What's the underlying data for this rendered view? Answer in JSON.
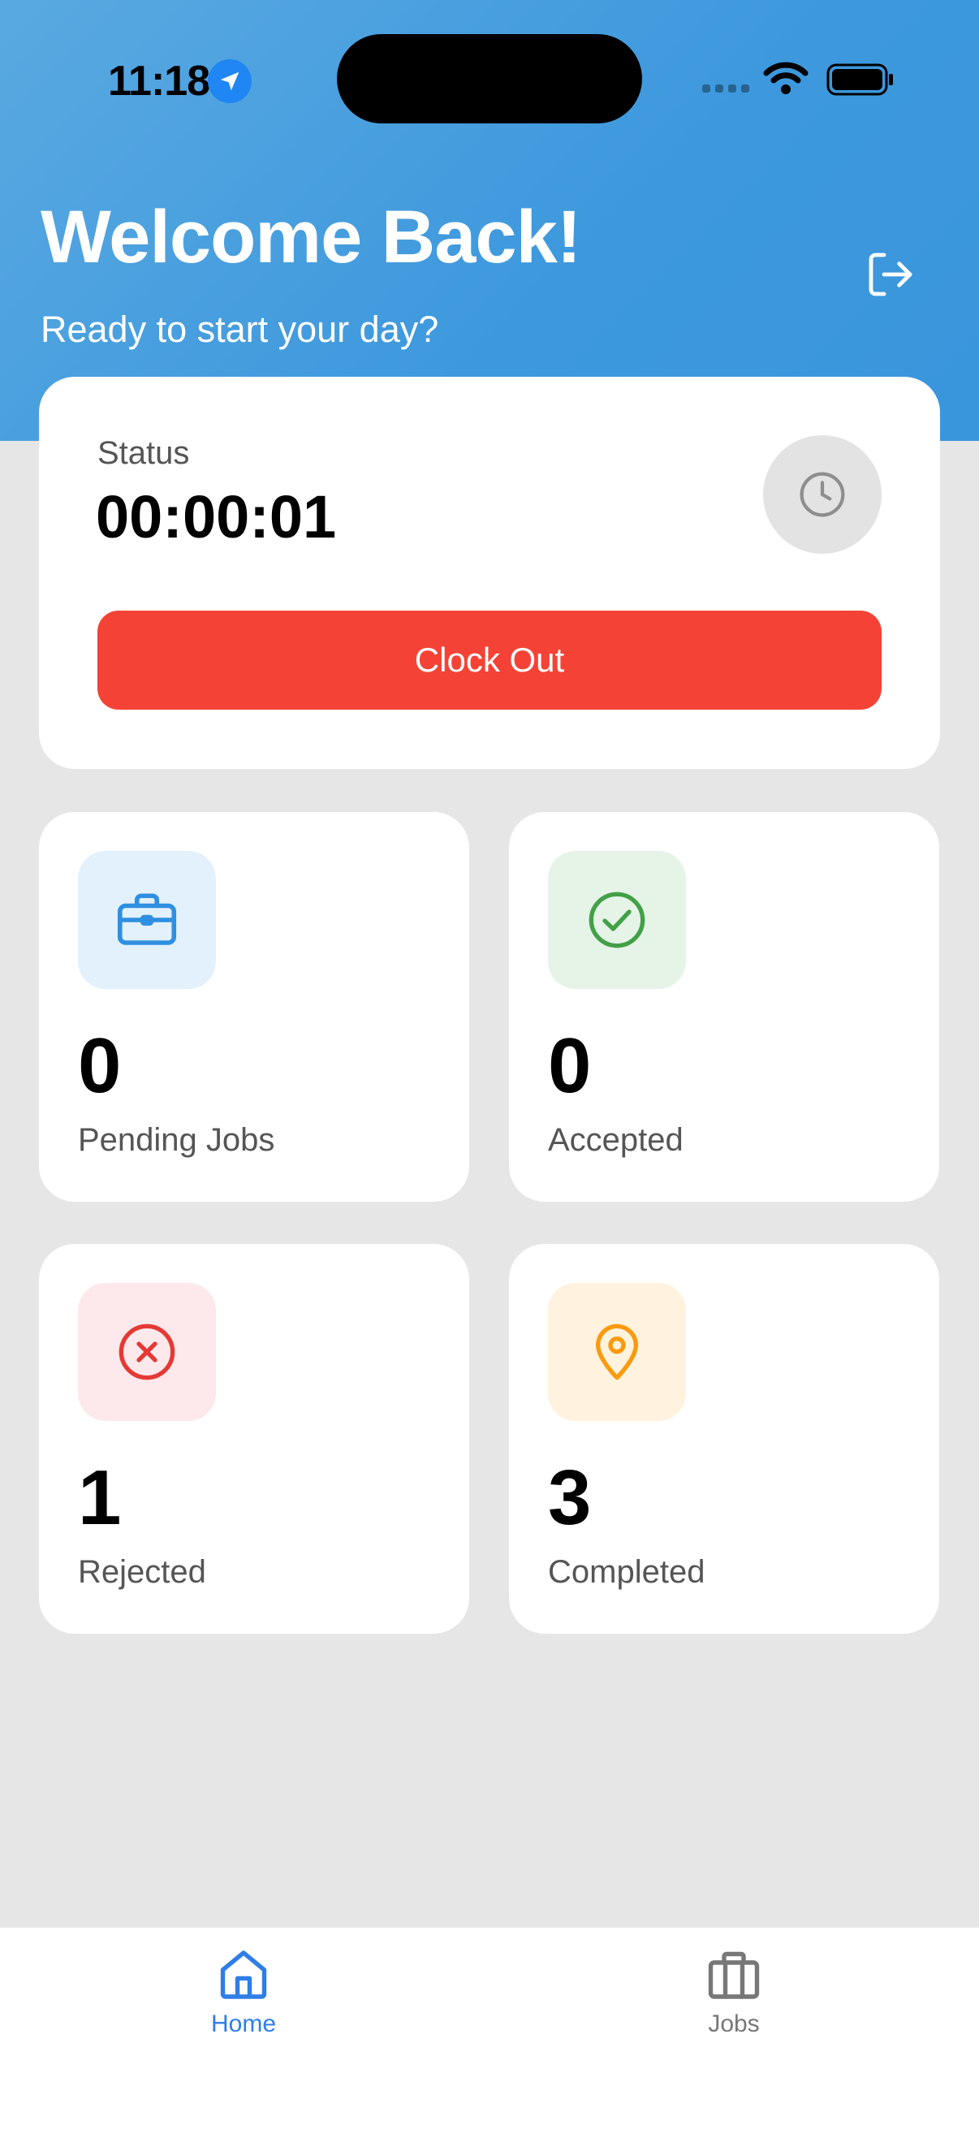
{
  "status_bar": {
    "time": "11:18",
    "location_icon": "location-arrow-icon",
    "signal_icon": "cellular-signal-icon",
    "wifi_icon": "wifi-icon",
    "battery_icon": "battery-icon"
  },
  "header": {
    "title": "Welcome Back!",
    "subtitle": "Ready to start your day?",
    "logout_icon": "logout-icon",
    "gradient_start": "#59a9e1",
    "gradient_end": "#3a96dc"
  },
  "status_card": {
    "label": "Status",
    "timer": "00:00:01",
    "clock_icon": "clock-icon",
    "button_label": "Clock Out",
    "button_color": "#f44336"
  },
  "stats": [
    {
      "value": "0",
      "label": "Pending Jobs",
      "icon": "briefcase-icon",
      "color": "#2f8fe0",
      "bg": "#e3f1fd"
    },
    {
      "value": "0",
      "label": "Accepted",
      "icon": "check-circle-icon",
      "color": "#43a047",
      "bg": "#e6f4e7"
    },
    {
      "value": "1",
      "label": "Rejected",
      "icon": "x-circle-icon",
      "color": "#e53935",
      "bg": "#fde9eb"
    },
    {
      "value": "3",
      "label": "Completed",
      "icon": "map-pin-icon",
      "color": "#fb9a0e",
      "bg": "#fff2de"
    }
  ],
  "tabbar": {
    "tabs": [
      {
        "label": "Home",
        "icon": "home-icon",
        "active": true
      },
      {
        "label": "Jobs",
        "icon": "briefcase-icon",
        "active": false
      }
    ],
    "active_color": "#2f7ee6",
    "inactive_color": "#777777"
  }
}
